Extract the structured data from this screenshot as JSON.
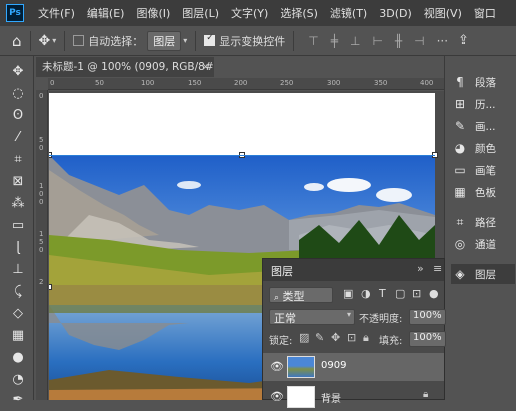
{
  "menubar": {
    "logo": "Ps",
    "items": [
      "文件(F)",
      "编辑(E)",
      "图像(I)",
      "图层(L)",
      "文字(Y)",
      "选择(S)",
      "滤镜(T)",
      "3D(D)",
      "视图(V)",
      "窗口"
    ]
  },
  "options": {
    "auto_select_label": "自动选择：",
    "auto_select_target": "图层",
    "show_transform_label": "显示变换控件"
  },
  "document": {
    "tab_title": "未标题-1 @ 100% (0909, RGB/8#) *"
  },
  "ruler": {
    "top_ticks": [
      "0",
      "50",
      "100",
      "150",
      "200",
      "250",
      "300",
      "350",
      "400"
    ],
    "left_ticks": [
      "0",
      "5",
      "0",
      "1",
      "0",
      "0",
      "1",
      "5",
      "0",
      "2"
    ]
  },
  "dock": {
    "items": [
      "段落",
      "历...",
      "画...",
      "颜色",
      "画笔",
      "色板",
      "路径",
      "通道",
      "图层"
    ]
  },
  "layers": {
    "panel_title": "图层",
    "filter_label": "类型",
    "blend_mode": "正常",
    "opacity_label": "不透明度:",
    "opacity_value": "100%",
    "lock_label": "锁定:",
    "fill_label": "填充:",
    "fill_value": "100%",
    "rows": [
      {
        "name": "0909"
      },
      {
        "name": "背景"
      }
    ]
  }
}
